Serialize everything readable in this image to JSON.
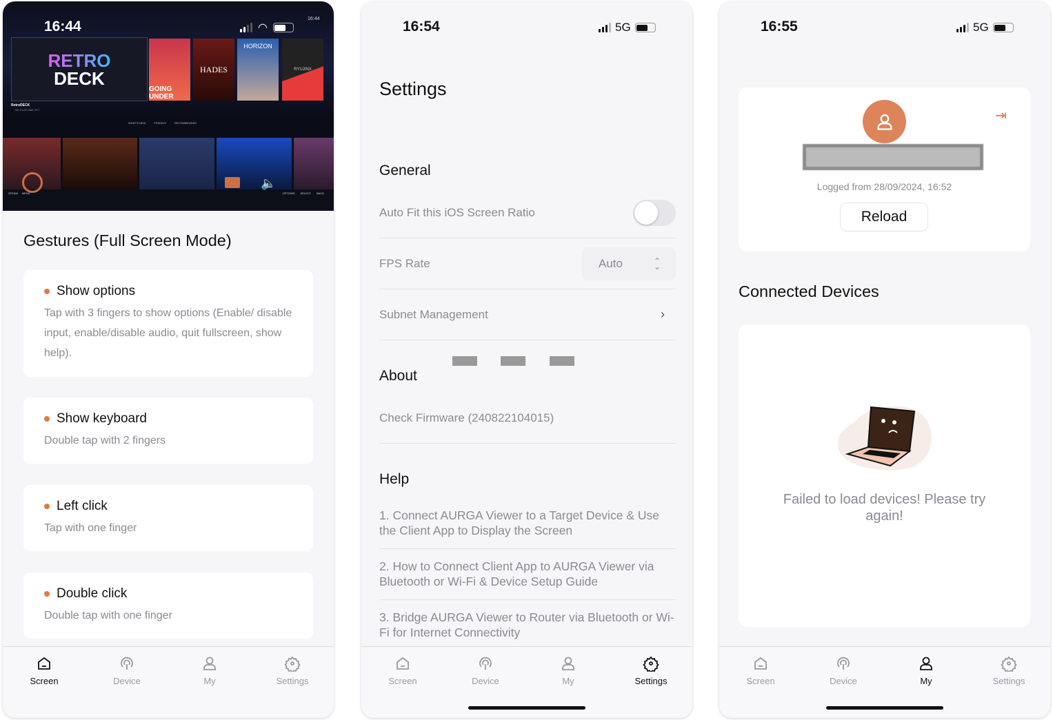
{
  "tabs": [
    {
      "label": "Screen",
      "icon": "home-icon"
    },
    {
      "label": "Device",
      "icon": "broadcast-icon"
    },
    {
      "label": "My",
      "icon": "user-icon"
    },
    {
      "label": "Settings",
      "icon": "gear-icon"
    }
  ],
  "screen1": {
    "time": "16:44",
    "game_image": {
      "logo_text": "RETRO DECK",
      "game_title": "RetroDECK",
      "playtime": "NO PLAYTIME YET",
      "tabs": [
        "WHAT'S NEW",
        "FRIENDS",
        "RECOMMENDED"
      ],
      "clock": "16:44",
      "tiles": [
        "GOING UNDER",
        "HADES",
        "HORIZON",
        "RYUJINX"
      ],
      "footer": [
        "STEAM",
        "MENU",
        "OPTIONS",
        "SELECT",
        "BACK"
      ]
    },
    "title": "Gestures (Full Screen Mode)",
    "gestures": [
      {
        "title": "Show options",
        "desc": "Tap with 3 fingers to show options (Enable/ disable input, enable/disable audio, quit fullscreen, show help)."
      },
      {
        "title": "Show keyboard",
        "desc": "Double tap with 2 fingers"
      },
      {
        "title": "Left click",
        "desc": "Tap with one finger"
      },
      {
        "title": "Double click",
        "desc": "Double tap with one finger"
      }
    ],
    "active_tab": "Screen"
  },
  "screen2": {
    "time": "16:54",
    "network": "5G",
    "title": "Settings",
    "general": "General",
    "auto_fit": {
      "label": "Auto Fit this iOS Screen Ratio",
      "enabled": false
    },
    "fps": {
      "label": "FPS Rate",
      "value": "Auto"
    },
    "subnet": "Subnet Management",
    "about": "About",
    "firmware": "Check Firmware (240822104015)",
    "help": "Help",
    "help_items": [
      "1. Connect AURGA Viewer to a Target Device & Use the Client App to Display the Screen",
      "2. How to Connect Client App to AURGA Viewer via Bluetooth or Wi-Fi & Device Setup Guide",
      "3. Bridge AURGA Viewer to Router via Bluetooth or Wi-Fi for Internet Connectivity"
    ],
    "active_tab": "Settings"
  },
  "screen3": {
    "time": "16:55",
    "network": "5G",
    "logged": "Logged from 28/09/2024, 16:52",
    "reload": "Reload",
    "connected": "Connected Devices",
    "error": "Failed to load devices! Please try again!",
    "active_tab": "My"
  },
  "colors": {
    "accent": "#e07a45",
    "active_tab": "#111111",
    "inactive_tab": "#9a9aa2"
  }
}
